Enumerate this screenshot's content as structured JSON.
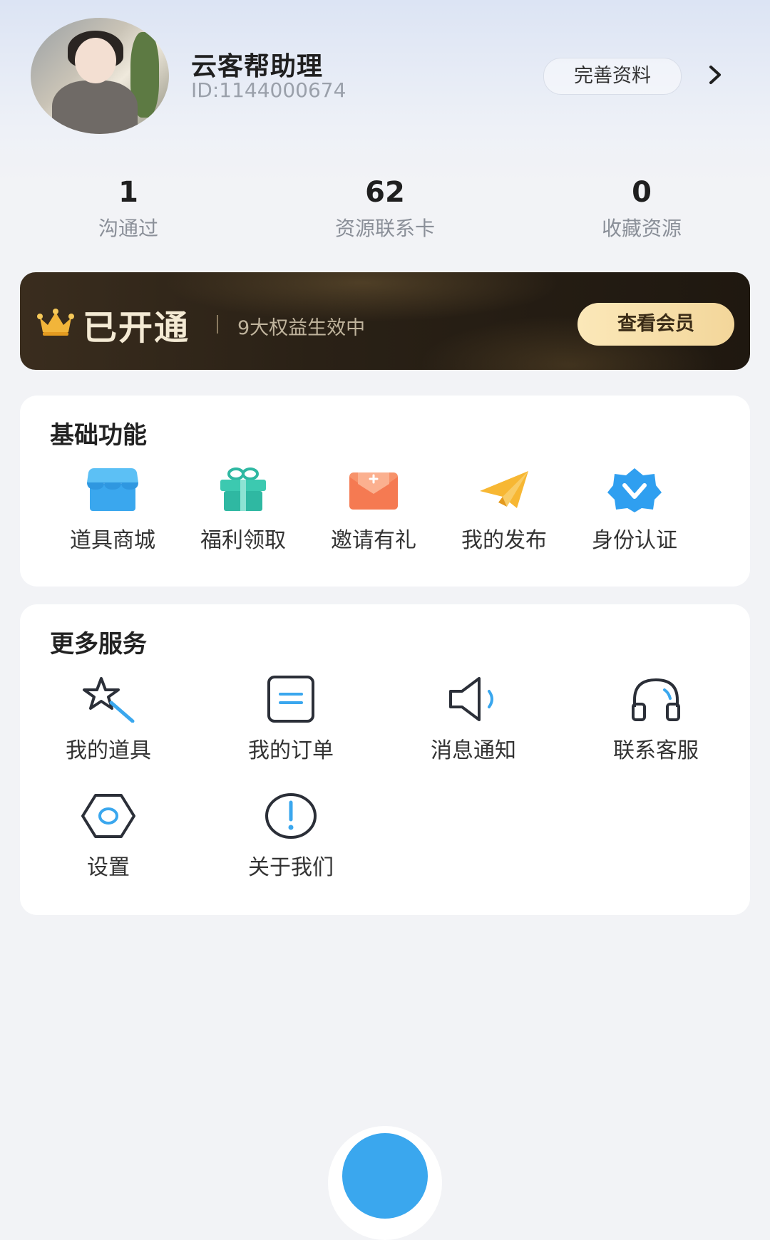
{
  "profile": {
    "name": "云客帮助理",
    "id": "ID:1144000674",
    "edit_label": "完善资料"
  },
  "stats": [
    {
      "value": "1",
      "label": "沟通过"
    },
    {
      "value": "62",
      "label": "资源联系卡"
    },
    {
      "value": "0",
      "label": "收藏资源"
    }
  ],
  "vip": {
    "status": "已开通",
    "benefits": "9大权益生效中",
    "button": "查看会员"
  },
  "basic": {
    "title": "基础功能",
    "items": [
      {
        "label": "道具商城",
        "icon": "store-icon"
      },
      {
        "label": "福利领取",
        "icon": "gift-icon"
      },
      {
        "label": "邀请有礼",
        "icon": "envelope-icon"
      },
      {
        "label": "我的发布",
        "icon": "paper-plane-icon"
      },
      {
        "label": "身份认证",
        "icon": "verified-badge-icon"
      }
    ]
  },
  "more": {
    "title": "更多服务",
    "items": [
      {
        "label": "我的道具",
        "icon": "magic-wand-icon"
      },
      {
        "label": "我的订单",
        "icon": "order-icon"
      },
      {
        "label": "消息通知",
        "icon": "speaker-icon"
      },
      {
        "label": "联系客服",
        "icon": "headset-icon"
      },
      {
        "label": "设置",
        "icon": "settings-icon"
      },
      {
        "label": "关于我们",
        "icon": "info-icon"
      }
    ]
  },
  "colors": {
    "accent": "#3aa7ee",
    "vip_gold": "#f3d69a",
    "vip_dark": "#2a2116"
  }
}
